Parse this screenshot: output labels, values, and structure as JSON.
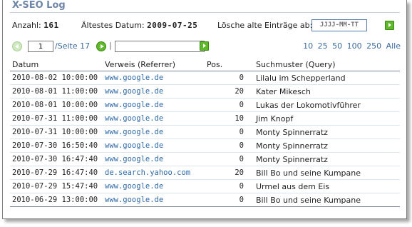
{
  "title": "X-SEO Log",
  "summary": {
    "count_label": "Anzahl:",
    "count_value": "161",
    "oldest_label": "Ältestes Datum:",
    "oldest_value": "2009-07-25",
    "delete_label": "Lösche alte Einträge ab:",
    "delete_placeholder": "JJJJ-MM-TT"
  },
  "pager": {
    "current_page": "1",
    "page_of_text": "/Seite 17",
    "separator": "|",
    "filter_value": "",
    "per_page_options": [
      "10",
      "25",
      "50",
      "100",
      "250",
      "Alle"
    ]
  },
  "table": {
    "headers": {
      "date": "Datum",
      "referrer": "Verweis (Referrer)",
      "pos": "Pos.",
      "query": "Suchmuster (Query)"
    },
    "rows": [
      {
        "date": "2010-08-02 10:00:00",
        "referrer": "www.google.de",
        "pos": "0",
        "query": "Lilalu im Schepperland"
      },
      {
        "date": "2010-08-01 11:00:00",
        "referrer": "www.google.de",
        "pos": "20",
        "query": "Kater Mikesch"
      },
      {
        "date": "2010-08-01 10:00:00",
        "referrer": "www.google.de",
        "pos": "0",
        "query": "Lukas der Lokomotivführer"
      },
      {
        "date": "2010-07-31 11:00:00",
        "referrer": "www.google.de",
        "pos": "10",
        "query": "Jim Knopf"
      },
      {
        "date": "2010-07-31 10:00:00",
        "referrer": "www.google.de",
        "pos": "0",
        "query": "Monty Spinnerratz"
      },
      {
        "date": "2010-07-30 16:50:40",
        "referrer": "www.google.de",
        "pos": "0",
        "query": "Monty Spinnerratz"
      },
      {
        "date": "2010-07-30 16:47:40",
        "referrer": "www.google.de",
        "pos": "0",
        "query": "Monty Spinnerratz"
      },
      {
        "date": "2010-07-29 16:47:40",
        "referrer": "de.search.yahoo.com",
        "pos": "20",
        "query": "Bill Bo und seine Kumpane"
      },
      {
        "date": "2010-07-29 15:47:40",
        "referrer": "www.google.de",
        "pos": "0",
        "query": "Urmel aus dem Eis"
      },
      {
        "date": "2010-06-29 13:00:00",
        "referrer": "www.google.de",
        "pos": "0",
        "query": "Bill Bo und seine Kumpane"
      }
    ]
  },
  "colors": {
    "title": "#6e86a8",
    "link": "#2e6aa8",
    "go_button": "#5fb82a"
  }
}
